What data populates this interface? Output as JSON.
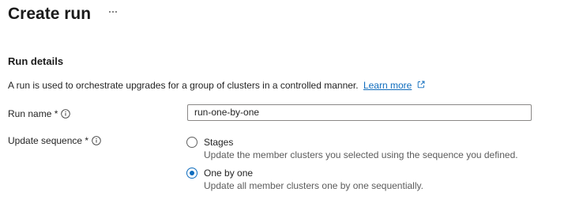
{
  "header": {
    "title": "Create run",
    "more_icon": "more-horizontal-icon"
  },
  "section": {
    "heading": "Run details",
    "description": "A run is used to orchestrate upgrades for a group of clusters in a controlled manner.",
    "learn_more": "Learn more",
    "learn_more_icon": "external-link-icon"
  },
  "form": {
    "run_name": {
      "label": "Run name *",
      "info_icon": "info-icon",
      "value": "run-one-by-one"
    },
    "update_sequence": {
      "label": "Update sequence *",
      "info_icon": "info-icon",
      "options": [
        {
          "label": "Stages",
          "description": "Update the member clusters you selected using the sequence you defined.",
          "selected": false
        },
        {
          "label": "One by one",
          "description": "Update all member clusters one by one sequentially.",
          "selected": true
        }
      ]
    }
  },
  "colors": {
    "accent": "#0f6cbd",
    "text": "#242424",
    "secondary_text": "#5c5c5c",
    "input_border": "#8a8886"
  }
}
